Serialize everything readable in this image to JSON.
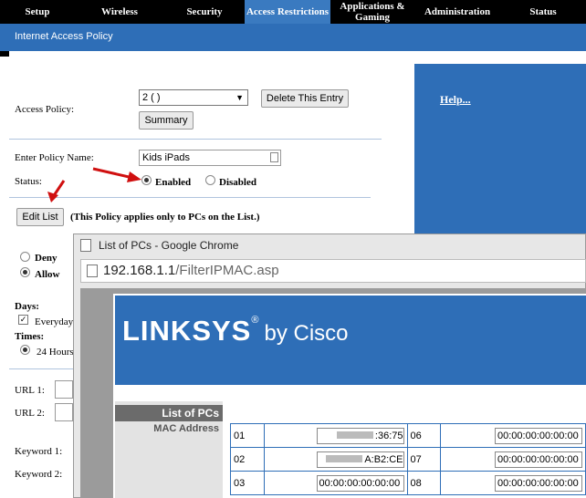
{
  "topnav": {
    "tabs": [
      {
        "label": "Setup"
      },
      {
        "label": "Wireless"
      },
      {
        "label": "Security"
      },
      {
        "label": "Access Restrictions"
      },
      {
        "label": "Applications & Gaming"
      },
      {
        "label": "Administration"
      },
      {
        "label": "Status"
      }
    ]
  },
  "subnav": {
    "title": "Internet Access Policy"
  },
  "help": {
    "label": "Help..."
  },
  "form": {
    "access_policy_label": "Access Policy:",
    "access_policy_value": "2 ( )",
    "delete_button": "Delete This Entry",
    "summary_button": "Summary",
    "policy_name_label": "Enter Policy Name:",
    "policy_name_value": "Kids iPads",
    "status_label": "Status:",
    "enabled_label": "Enabled",
    "disabled_label": "Disabled",
    "edit_list_button": "Edit List",
    "edit_list_note": "(This Policy applies only to PCs on the List.)",
    "deny_label": "Deny",
    "allow_label": "Allow",
    "days_label": "Days:",
    "everyday_label": "Everyday",
    "times_label": "Times:",
    "hours_label": "24 Hours",
    "url1_label": "URL 1:",
    "url2_label": "URL 2:",
    "keyword1_label": "Keyword 1:",
    "keyword2_label": "Keyword 2:"
  },
  "popup": {
    "window_title": "List of PCs - Google Chrome",
    "url_host": "192.168.1.1",
    "url_path": "/FilterIPMAC.asp",
    "logo_main": "LINKSYS",
    "logo_reg": "®",
    "logo_by": "by Cisco",
    "list_title": "List of PCs",
    "mac_header": "MAC Address",
    "rows": [
      {
        "num": "01",
        "value": ":36:75",
        "num2": "06",
        "value2": "00:00:00:00:00:00"
      },
      {
        "num": "02",
        "value": "A:B2:CE",
        "num2": "07",
        "value2": "00:00:00:00:00:00"
      },
      {
        "num": "03",
        "value": "00:00:00:00:00:00",
        "num2": "08",
        "value2": "00:00:00:00:00:00"
      }
    ]
  },
  "colors": {
    "brand_blue": "#2e6eb7",
    "arrow_red": "#d01010"
  }
}
